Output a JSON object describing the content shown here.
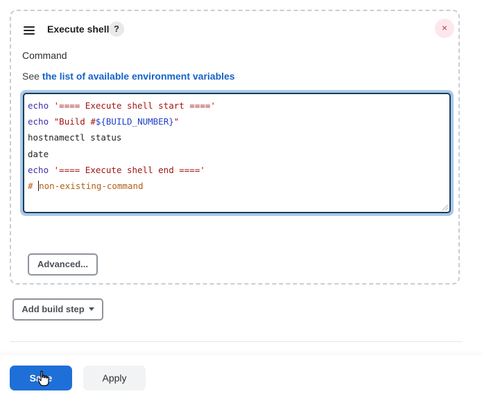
{
  "build_step": {
    "title": "Execute shell",
    "help_icon_glyph": "?",
    "close_icon_glyph": "×",
    "command_label": "Command",
    "help_text_prefix": "See ",
    "help_link_text": "the list of available environment variables",
    "advanced_button_label": "Advanced..."
  },
  "editor": {
    "lines": [
      [
        {
          "t": "echo",
          "c": "kw"
        },
        {
          "t": " ",
          "c": "plain"
        },
        {
          "t": "'==== Execute shell start ===='",
          "c": "str"
        }
      ],
      [
        {
          "t": "echo",
          "c": "kw"
        },
        {
          "t": " ",
          "c": "plain"
        },
        {
          "t": "\"Build #",
          "c": "str"
        },
        {
          "t": "${BUILD_NUMBER}",
          "c": "var"
        },
        {
          "t": "\"",
          "c": "str"
        }
      ],
      [
        {
          "t": "hostnamectl status",
          "c": "plain"
        }
      ],
      [
        {
          "t": "date",
          "c": "plain"
        }
      ],
      [
        {
          "t": "echo",
          "c": "kw"
        },
        {
          "t": " ",
          "c": "plain"
        },
        {
          "t": "'==== Execute shell end ===='",
          "c": "str"
        }
      ],
      [
        {
          "t": "# ",
          "c": "comment"
        },
        {
          "t": "|caret|",
          "c": "caret"
        },
        {
          "t": "non-existing-command",
          "c": "comment"
        }
      ]
    ]
  },
  "add_build_step_label": "Add build step",
  "footer": {
    "save_label": "Save",
    "apply_label": "Apply"
  },
  "colors": {
    "primary": "#1f6fd8",
    "close_bg": "#fce8ec",
    "close_fg": "#c4364f",
    "editor_focus_ring": "#a9c9ea"
  },
  "icons": {
    "drag_handle": "hamburger-icon",
    "help": "question-icon",
    "close": "close-icon",
    "dropdown": "chevron-down-icon",
    "cursor": "pointer-hand-icon"
  }
}
